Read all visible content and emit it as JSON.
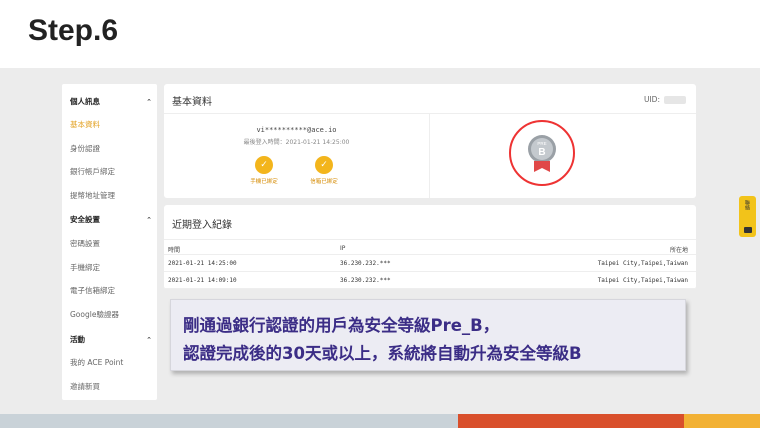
{
  "slide": {
    "title": "Step.6"
  },
  "sidebar": {
    "sections": [
      {
        "header": "個人訊息",
        "items": [
          "基本資料",
          "身份認證",
          "銀行帳戶綁定",
          "提幣地址管理"
        ]
      },
      {
        "header": "安全設置",
        "items": [
          "密碼設置",
          "手機綁定",
          "電子信箱綁定",
          "Google驗證器"
        ]
      },
      {
        "header": "活動",
        "items": [
          "我的 ACE Point",
          "邀請新買"
        ]
      }
    ],
    "active_item": "基本資料"
  },
  "profile_card": {
    "title": "基本資料",
    "uid_label": "UID:",
    "email": "vi**********@ace.io",
    "last_login": "最後登入時間：2021-01-21 14:25:00",
    "phone_label": "手機已綁定",
    "email_label": "信箱已綁定",
    "badge": {
      "top_text": "PRE",
      "letter": "B"
    }
  },
  "login_card": {
    "title": "近期登入紀錄",
    "columns": [
      "時間",
      "IP",
      "所在地"
    ],
    "rows": [
      {
        "time": "2021-01-21 14:25:00",
        "ip": "36.230.232.***",
        "location": "Taipei City,Taipei,Taiwan"
      },
      {
        "time": "2021-01-21 14:09:10",
        "ip": "36.230.232.***",
        "location": "Taipei City,Taipei,Taiwan"
      }
    ]
  },
  "callout": {
    "line1": "剛通過銀行認證的用戶為安全等級Pre_B，",
    "line2": "認證完成後的30天或以上，系統將自動升為安全等級B"
  },
  "side_tab": {
    "label": "聯絡"
  },
  "colors": {
    "accent": "#f3b51c",
    "callout_text": "#3b2d86",
    "badge_ring": "#e33333"
  }
}
